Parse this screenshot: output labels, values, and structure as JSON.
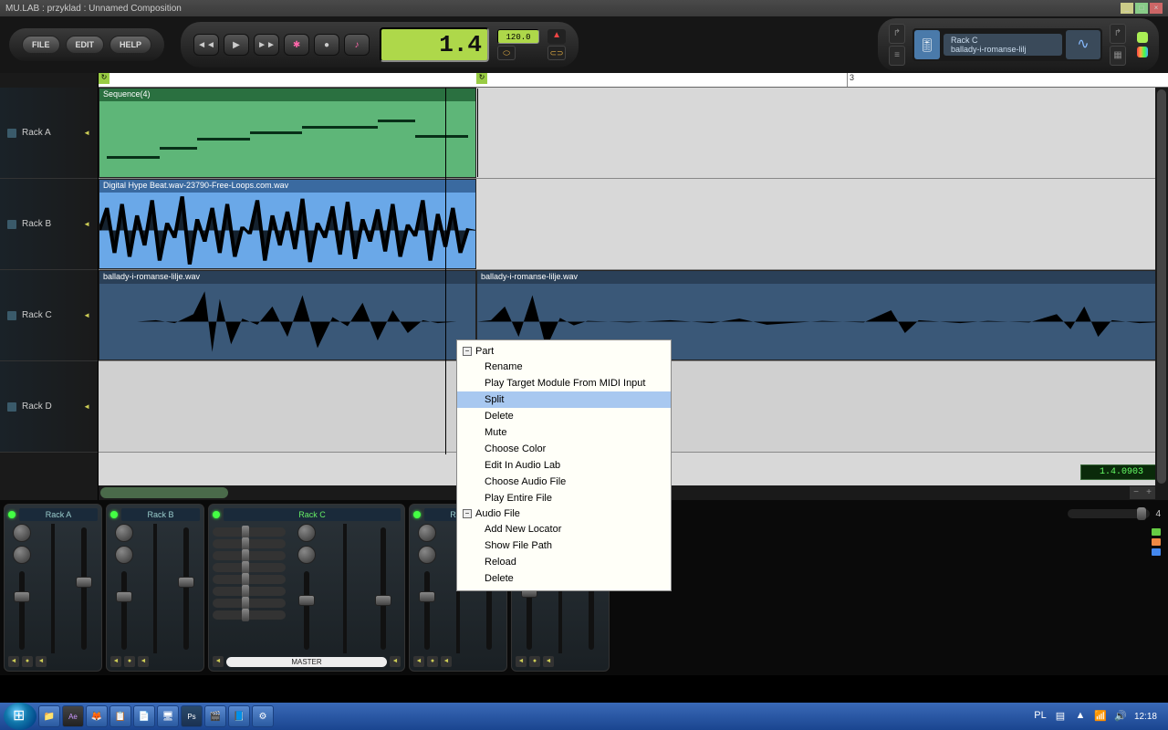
{
  "window": {
    "title": "MU.LAB : przyklad : Unnamed Composition"
  },
  "menu": {
    "file": "FILE",
    "edit": "EDIT",
    "help": "HELP"
  },
  "transport": {
    "position": "1.4",
    "tempo": "120.0",
    "position_readout": "1.4.0903"
  },
  "rack_indicator": {
    "title": "Rack C",
    "subtitle": "ballady-i-romanse-lilj"
  },
  "tracks": [
    {
      "name": "Rack A"
    },
    {
      "name": "Rack B"
    },
    {
      "name": "Rack C"
    },
    {
      "name": "Rack D"
    }
  ],
  "ruler": {
    "marker3": "3"
  },
  "clips": {
    "seq": "Sequence(4)",
    "audio_b": "Digital Hype Beat.wav-23790-Free-Loops.com.wav",
    "audio_c1": "ballady-i-romanse-lilje.wav",
    "audio_c2": "ballady-i-romanse-lilje.wav"
  },
  "context_menu": {
    "part_header": "Part",
    "audio_header": "Audio File",
    "items_part": [
      "Rename",
      "Play Target Module From MIDI Input",
      "Split",
      "Delete",
      "Mute",
      "Choose Color",
      "Edit In Audio Lab",
      "Choose Audio File",
      "Play Entire File"
    ],
    "items_audio": [
      "Add New Locator",
      "Show File Path",
      "Reload",
      "Delete"
    ],
    "highlighted": "Split"
  },
  "mixer": {
    "channels": [
      "Rack A",
      "Rack B",
      "Rack C",
      "Rack D"
    ],
    "master": "MASTER",
    "side_count": "4"
  },
  "taskbar": {
    "lang": "PL",
    "clock": "12:18"
  }
}
